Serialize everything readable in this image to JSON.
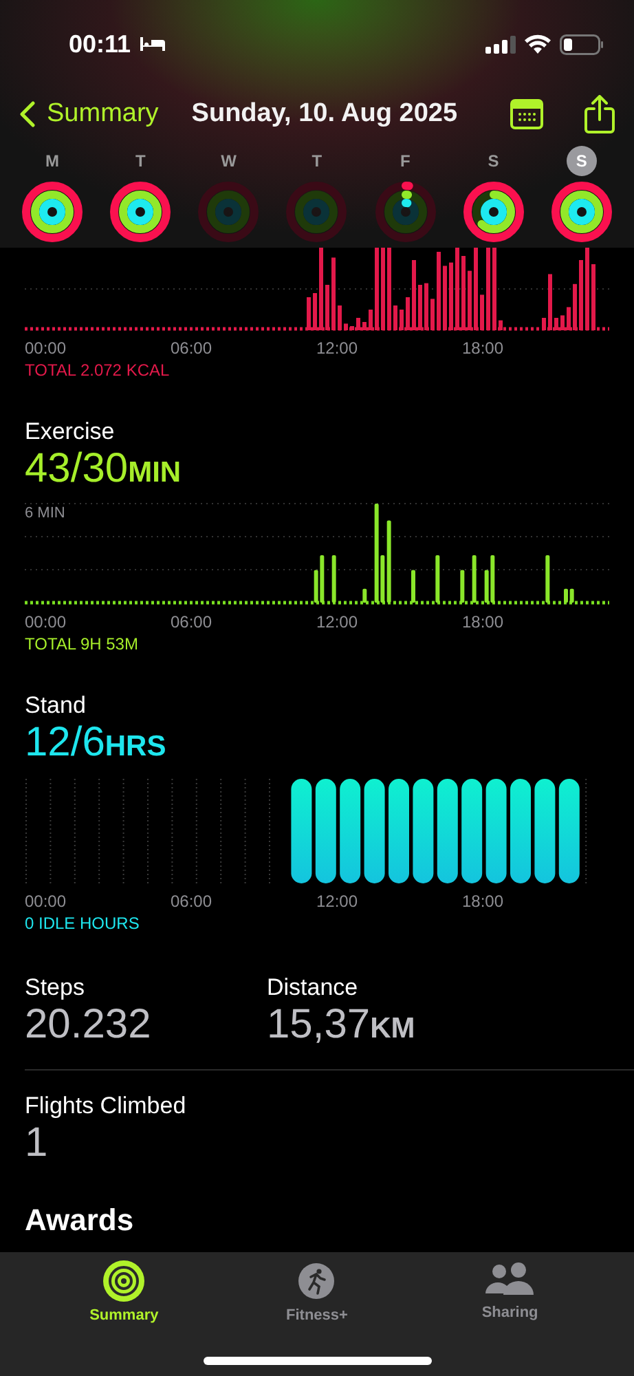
{
  "status_bar": {
    "time": "00:11"
  },
  "nav": {
    "back_label": "Summary",
    "title": "Sunday, 10. Aug 2025"
  },
  "days": [
    {
      "letter": "M",
      "selected": false
    },
    {
      "letter": "T",
      "selected": false
    },
    {
      "letter": "W",
      "selected": false
    },
    {
      "letter": "T",
      "selected": false
    },
    {
      "letter": "F",
      "selected": false
    },
    {
      "letter": "S",
      "selected": false
    },
    {
      "letter": "S",
      "selected": true
    }
  ],
  "move": {
    "axis": [
      "00:00",
      "06:00",
      "12:00",
      "18:00"
    ],
    "total": "TOTAL 2.072 KCAL"
  },
  "exercise": {
    "title": "Exercise",
    "value": "43/30",
    "unit": "MIN",
    "scale_label": "6 MIN",
    "axis": [
      "00:00",
      "06:00",
      "12:00",
      "18:00"
    ],
    "total": "TOTAL 9H 53M"
  },
  "stand": {
    "title": "Stand",
    "value": "12/6",
    "unit": "HRS",
    "axis": [
      "00:00",
      "06:00",
      "12:00",
      "18:00"
    ],
    "total": "0 IDLE HOURS"
  },
  "stats": [
    {
      "label": "Steps",
      "value": "20.232"
    },
    {
      "label": "Distance",
      "value": "15,37",
      "unit": "KM"
    }
  ],
  "flights": {
    "label": "Flights Climbed",
    "value": "1"
  },
  "awards": {
    "title": "Awards"
  },
  "tabs": [
    {
      "label": "Summary",
      "selected": true
    },
    {
      "label": "Fitness+",
      "selected": false
    },
    {
      "label": "Sharing",
      "selected": false
    }
  ]
}
